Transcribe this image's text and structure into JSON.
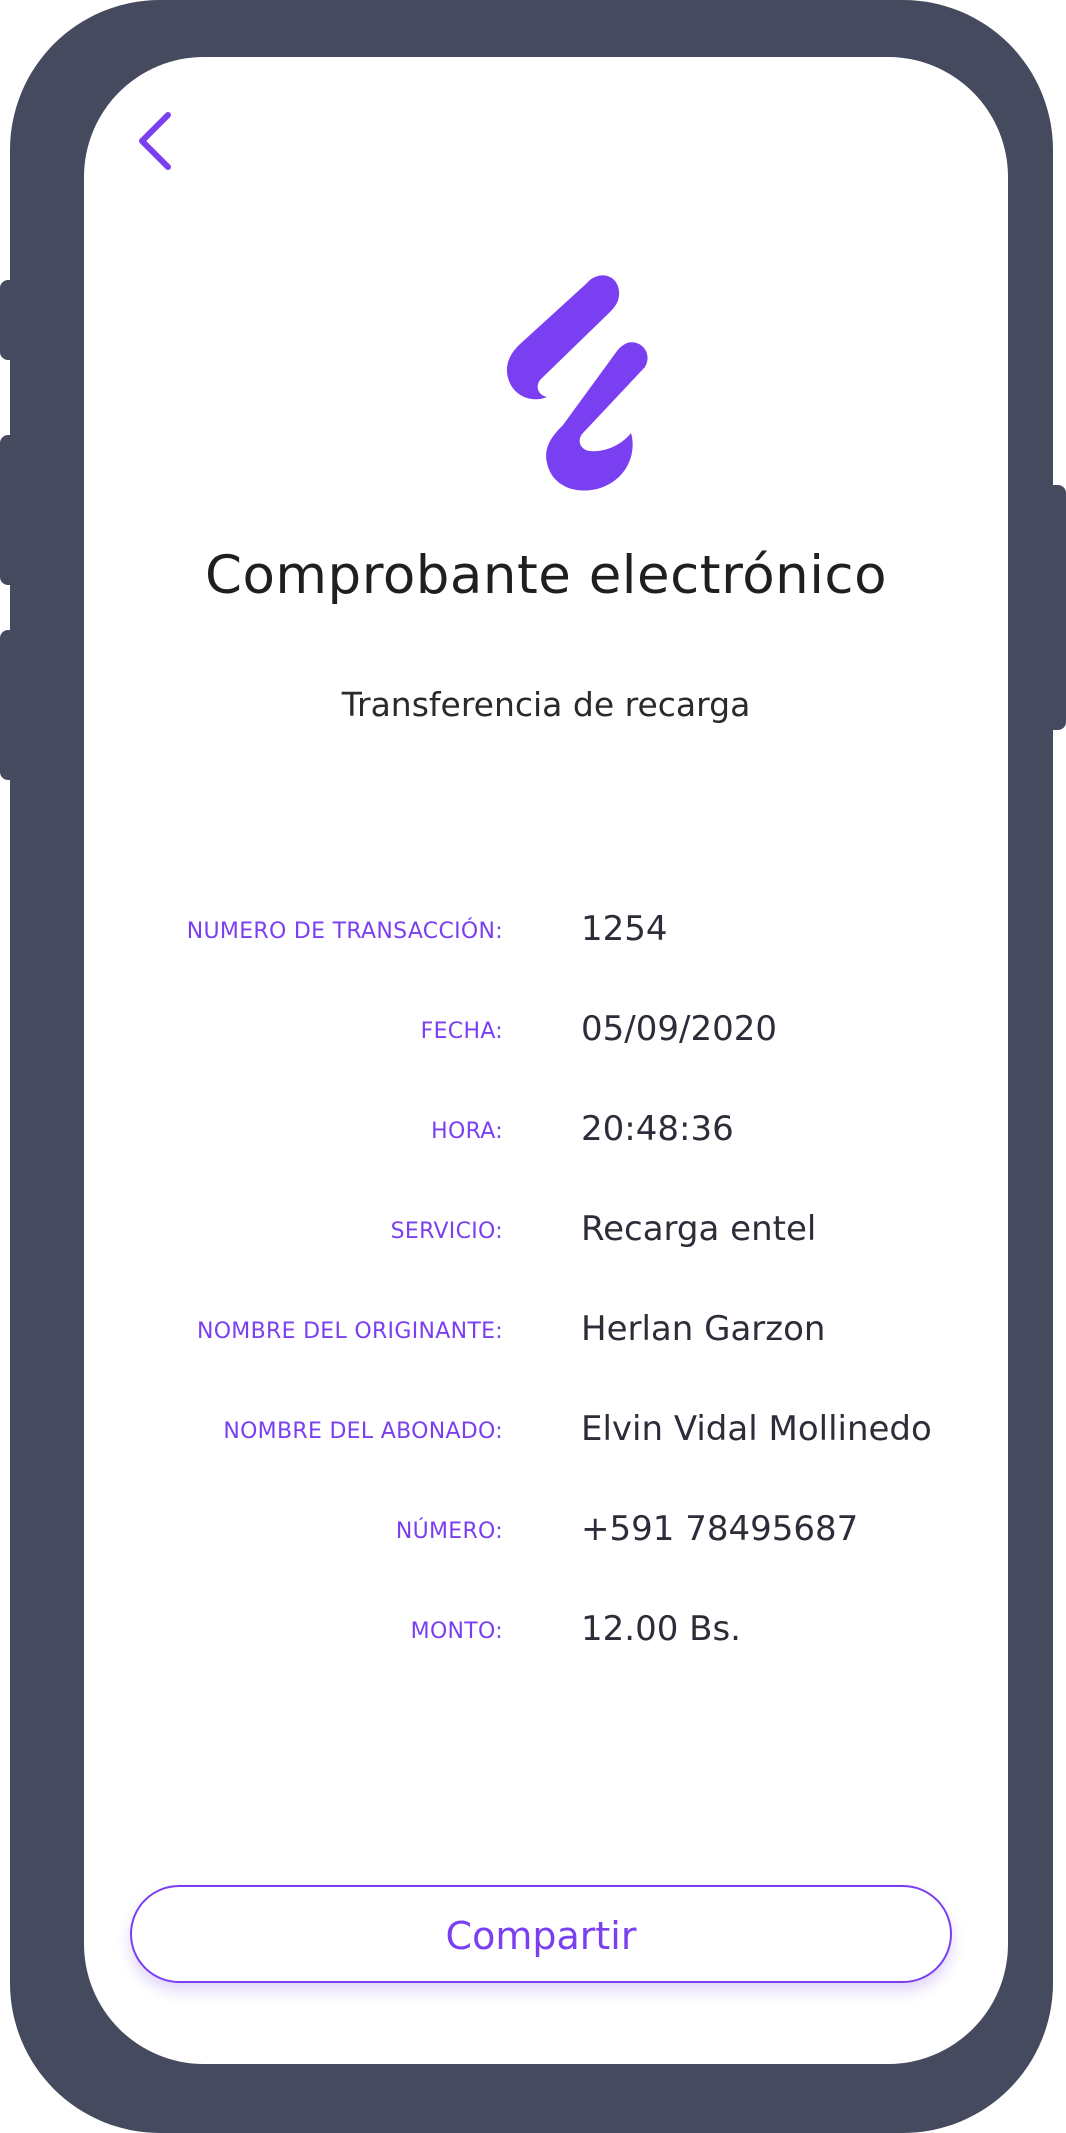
{
  "header": {
    "back_icon": "chevron-left-icon"
  },
  "brand": {
    "logo_icon": "brand-logo-icon",
    "accent_color": "#7b3ff2"
  },
  "receipt": {
    "title": "Comprobante electrónico",
    "subtitle": "Transferencia de recarga",
    "fields": [
      {
        "label": "NUMERO DE TRANSACCIÓN:",
        "value": "1254"
      },
      {
        "label": "FECHA:",
        "value": "05/09/2020"
      },
      {
        "label": "HORA:",
        "value": "20:48:36"
      },
      {
        "label": "SERVICIO:",
        "value": "Recarga entel"
      },
      {
        "label": "NOMBRE DEL ORIGINANTE:",
        "value": "Herlan Garzon"
      },
      {
        "label": "NOMBRE DEL ABONADO:",
        "value": "Elvin Vidal Mollinedo"
      },
      {
        "label": "NÚMERO:",
        "value": "+591 78495687"
      },
      {
        "label": "MONTO:",
        "value": "12.00 Bs."
      }
    ]
  },
  "actions": {
    "share_label": "Compartir"
  },
  "device": {
    "frame_color": "#454a5f"
  }
}
